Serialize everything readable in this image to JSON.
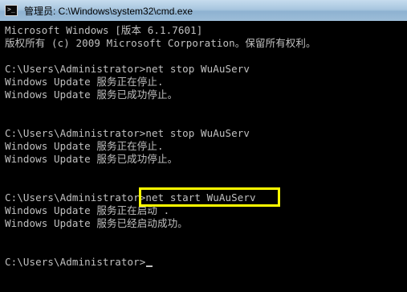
{
  "window": {
    "title": "管理员: C:\\Windows\\system32\\cmd.exe",
    "icon": "cmd-icon"
  },
  "console": {
    "lines": [
      "Microsoft Windows [版本 6.1.7601]",
      "版权所有 (c) 2009 Microsoft Corporation。保留所有权利。",
      "",
      "C:\\Users\\Administrator>net stop WuAuServ",
      "Windows Update 服务正在停止.",
      "Windows Update 服务已成功停止。",
      "",
      "",
      "C:\\Users\\Administrator>net stop WuAuServ",
      "Windows Update 服务正在停止.",
      "Windows Update 服务已成功停止。",
      "",
      "",
      "C:\\Users\\Administrator>net start WuAuServ",
      "Windows Update 服务正在启动 .",
      "Windows Update 服务已经启动成功。",
      "",
      "",
      "C:\\Users\\Administrator>"
    ],
    "highlight_color": "#ffff00",
    "text_color": "#c0c0c0",
    "background_color": "#000000"
  }
}
